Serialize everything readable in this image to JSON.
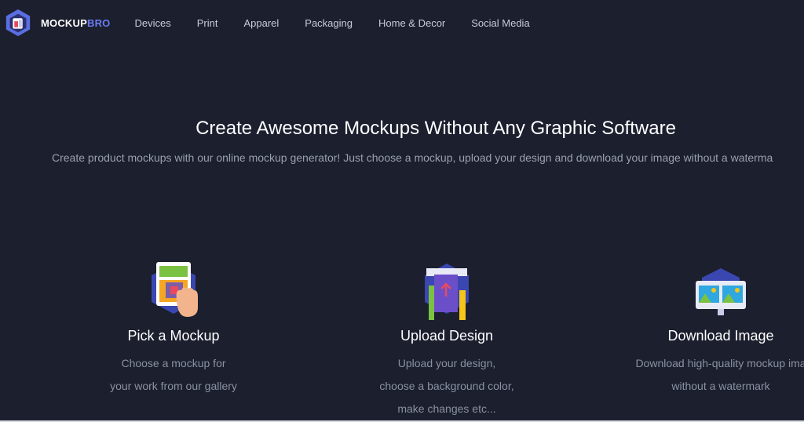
{
  "brand": {
    "name_part1": "MOCKUP",
    "name_part2": "BRO"
  },
  "nav": {
    "items": [
      {
        "label": "Devices"
      },
      {
        "label": "Print"
      },
      {
        "label": "Apparel"
      },
      {
        "label": "Packaging"
      },
      {
        "label": "Home & Decor"
      },
      {
        "label": "Social Media"
      }
    ]
  },
  "hero": {
    "title": "Create Awesome Mockups Without Any Graphic Software",
    "subtitle": "Create product mockups with our online mockup generator! Just choose a mockup, upload your design and download your image without a waterma"
  },
  "steps": [
    {
      "icon": "pick-mockup-icon",
      "title": "Pick a Mockup",
      "desc": [
        "Choose a mockup for",
        "your work from our gallery"
      ]
    },
    {
      "icon": "upload-design-icon",
      "title": "Upload Design",
      "desc": [
        "Upload your design,",
        "choose a background color,",
        "make changes etc..."
      ]
    },
    {
      "icon": "download-image-icon",
      "title": "Download Image",
      "desc": [
        "Download high-quality mockup ima",
        "without a watermark"
      ]
    }
  ],
  "colors": {
    "background": "#1b1f2e",
    "brand_accent": "#6c7cf2",
    "nav_text": "#c9ccd6",
    "muted_text": "#8b91a3"
  }
}
